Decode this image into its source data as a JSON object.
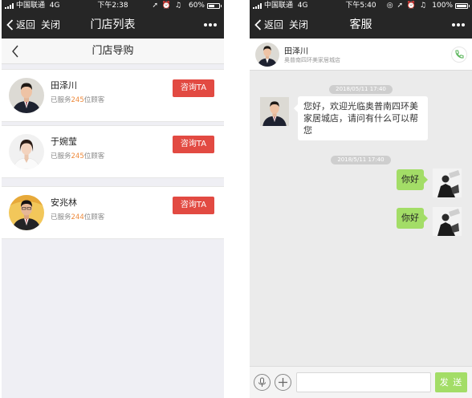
{
  "left_screen": {
    "status_bar": {
      "carrier": "中国联通",
      "network": "4G",
      "time": "下午2:38",
      "battery": "60%",
      "battery_level": 0.6
    },
    "nav": {
      "back_label": "返回",
      "close_label": "关闭",
      "title": "门店列表"
    },
    "sub_header": {
      "title": "门店导购"
    },
    "guides": [
      {
        "name": "田泽川",
        "served_prefix": "已服务",
        "count": "245",
        "served_suffix": "位顾客",
        "button_label": "咨询TA"
      },
      {
        "name": "于婉莹",
        "served_prefix": "已服务",
        "count": "245",
        "served_suffix": "位顾客",
        "button_label": "咨询TA"
      },
      {
        "name": "安兆林",
        "served_prefix": "已服务",
        "count": "244",
        "served_suffix": "位顾客",
        "button_label": "咨询TA"
      }
    ]
  },
  "right_screen": {
    "status_bar": {
      "carrier": "中国联通",
      "network": "4G",
      "time": "下午5:40",
      "battery": "100%",
      "battery_level": 1.0
    },
    "nav": {
      "back_label": "返回",
      "close_label": "关闭",
      "title": "客服"
    },
    "contact": {
      "name": "田泽川",
      "store": "奥普南四环美家居城店"
    },
    "messages": {
      "timestamp_1": "2018/05/11 17:40",
      "incoming_text": "您好，欢迎光临奥普南四环美家居城店，请问有什么可以帮您",
      "timestamp_2": "2018/5/11 17:40",
      "outgoing_1": "你好",
      "outgoing_2": "你好"
    },
    "input": {
      "send_label": "发 送",
      "placeholder": ""
    }
  },
  "colors": {
    "nav_bg": "#262626",
    "consult_button": "#e24a42",
    "served_count": "#ee8a3c",
    "outgoing_bubble": "#a3dd67",
    "send_button": "#a3dd67",
    "phone_icon": "#5fb75f"
  }
}
